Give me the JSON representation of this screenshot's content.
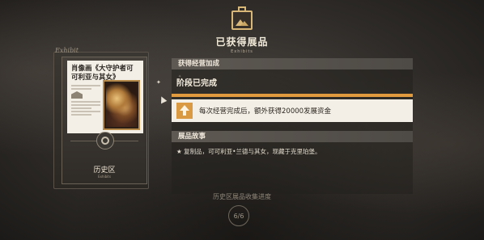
{
  "header": {
    "icon": "picture-frame-icon",
    "title": "已获得展品",
    "subtitle": "Exhibits"
  },
  "card": {
    "tag": "Exhibit",
    "title": "肖像画《大守护者可可利亚与其女》",
    "region": "历史区",
    "region_sub": "Exhibits"
  },
  "stage": {
    "section_label": "获得经营加成",
    "title": "阶段已完成",
    "progress_fraction": 1.0,
    "accent_color": "#e19a3d",
    "reward_icon": "level-up-arrow-icon",
    "reward_text": "每次经营完成后，额外获得20000发展资金"
  },
  "story": {
    "section_label": "展品故事",
    "text": "★ 复制品，可可利亚•兰德与其女，现藏于克里珀堡。"
  },
  "collection": {
    "label": "历史区展品收集进度",
    "value": "6/6"
  }
}
